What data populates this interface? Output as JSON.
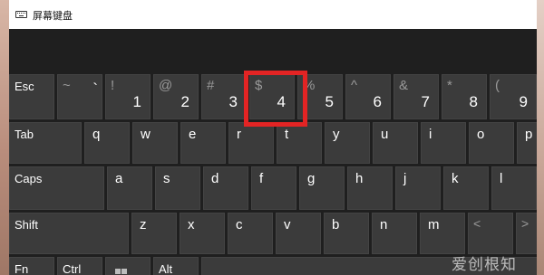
{
  "window": {
    "title": "屏幕键盘"
  },
  "rows": {
    "row1": [
      {
        "id": "esc",
        "label": "Esc"
      },
      {
        "id": "backtick",
        "shift": "~",
        "main": "`"
      },
      {
        "id": "1",
        "shift": "!",
        "main": "1"
      },
      {
        "id": "2",
        "shift": "@",
        "main": "2"
      },
      {
        "id": "3",
        "shift": "#",
        "main": "3"
      },
      {
        "id": "4",
        "shift": "$",
        "main": "4"
      },
      {
        "id": "5",
        "shift": "%",
        "main": "5"
      },
      {
        "id": "6",
        "shift": "^",
        "main": "6"
      },
      {
        "id": "7",
        "shift": "&",
        "main": "7"
      },
      {
        "id": "8",
        "shift": "*",
        "main": "8"
      },
      {
        "id": "9",
        "shift": "(",
        "main": "9"
      }
    ],
    "row2": [
      {
        "id": "tab",
        "label": "Tab"
      },
      {
        "id": "q",
        "char": "q"
      },
      {
        "id": "w",
        "char": "w"
      },
      {
        "id": "e",
        "char": "e"
      },
      {
        "id": "r",
        "char": "r"
      },
      {
        "id": "t",
        "char": "t"
      },
      {
        "id": "y",
        "char": "y"
      },
      {
        "id": "u",
        "char": "u"
      },
      {
        "id": "i",
        "char": "i"
      },
      {
        "id": "o",
        "char": "o"
      },
      {
        "id": "p",
        "char": "p"
      }
    ],
    "row3": [
      {
        "id": "caps",
        "label": "Caps"
      },
      {
        "id": "a",
        "char": "a"
      },
      {
        "id": "s",
        "char": "s"
      },
      {
        "id": "d",
        "char": "d"
      },
      {
        "id": "f",
        "char": "f"
      },
      {
        "id": "g",
        "char": "g"
      },
      {
        "id": "h",
        "char": "h"
      },
      {
        "id": "j",
        "char": "j"
      },
      {
        "id": "k",
        "char": "k"
      },
      {
        "id": "l",
        "char": "l"
      }
    ],
    "row4": [
      {
        "id": "shift",
        "label": "Shift"
      },
      {
        "id": "z",
        "char": "z"
      },
      {
        "id": "x",
        "char": "x"
      },
      {
        "id": "c",
        "char": "c"
      },
      {
        "id": "v",
        "char": "v"
      },
      {
        "id": "b",
        "char": "b"
      },
      {
        "id": "n",
        "char": "n"
      },
      {
        "id": "m",
        "char": "m"
      },
      {
        "id": "comma",
        "shift": "<",
        "char": ""
      },
      {
        "id": "period",
        "shift": ">",
        "char": ""
      }
    ],
    "row5": [
      {
        "id": "fn",
        "label": "Fn"
      },
      {
        "id": "ctrl",
        "label": "Ctrl"
      },
      {
        "id": "win",
        "icon": "windows-logo-icon"
      },
      {
        "id": "alt",
        "label": "Alt"
      }
    ]
  },
  "highlight": {
    "key": "4",
    "color": "#e32424"
  },
  "watermark": {
    "text": "爱创根知识网"
  },
  "colors": {
    "key_bg": "#3b3b3b",
    "board_bg": "#1f1f1f",
    "shift_char": "#9a9a9a"
  }
}
